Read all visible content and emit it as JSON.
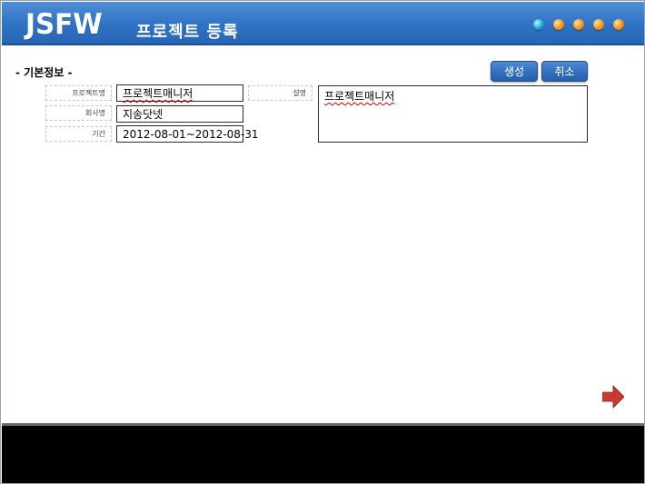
{
  "header": {
    "logo": "JSFW",
    "title": "프로젝트 등록",
    "colors": {
      "bar": "#2f72c4",
      "dot_blue": "#21a7d3",
      "dot_orange": "#f5921a"
    }
  },
  "section": {
    "label": "- 기본정보 -"
  },
  "buttons": {
    "create": "생성",
    "cancel": "취소"
  },
  "form": {
    "project_name": {
      "label": "프로젝트명",
      "value": "프로젝트매니저"
    },
    "company_name": {
      "label": "회사명",
      "value": "지송닷넷"
    },
    "period": {
      "label": "기간",
      "value": "2012-08-01~2012-08-31"
    },
    "description": {
      "label": "설명",
      "value": "프로젝트매니저"
    }
  },
  "icons": {
    "next": "right-arrow-icon"
  }
}
